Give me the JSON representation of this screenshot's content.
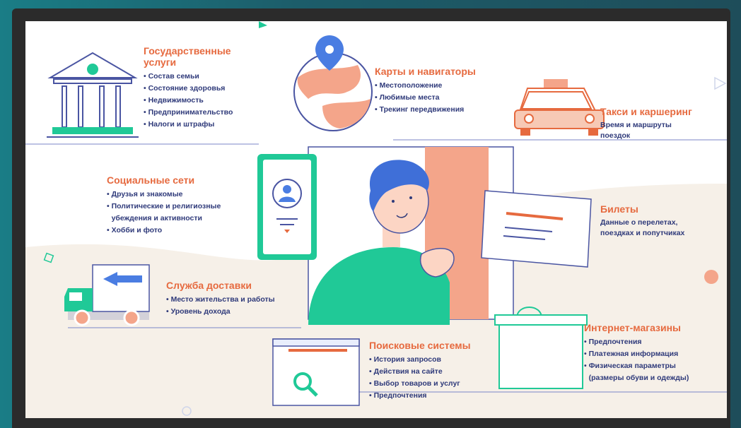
{
  "gov": {
    "title_line1": "Государственные",
    "title_line2": "услуги",
    "items": [
      "Состав семьи",
      "Состояние здоровья",
      "Недвижимость",
      "Предпринимательство",
      "Налоги и штрафы"
    ]
  },
  "maps": {
    "title": "Карты и навигаторы",
    "items": [
      "Местоположение",
      "Любимые места",
      "Трекинг  передвижения"
    ]
  },
  "taxi": {
    "title": "Такси и каршеринг",
    "desc_line1": "Время и маршруты",
    "desc_line2": "поездок"
  },
  "social": {
    "title": "Социальные сети",
    "items": [
      "Друзья и знакомые",
      "Политические и религиозные",
      "Хобби и фото"
    ],
    "item2_line2": "убеждения и активности"
  },
  "tickets": {
    "title": "Билеты",
    "desc_line1": "Данные о перелетах,",
    "desc_line2": "поездках и попутчиках"
  },
  "delivery": {
    "title": "Служба доставки",
    "items": [
      "Место жительства и работы",
      "Уровень дохода"
    ]
  },
  "search": {
    "title": "Поисковые системы",
    "items": [
      "История запросов",
      "Действия на сайте",
      "Выбор товаров и услуг",
      "Предпочтения"
    ]
  },
  "shops": {
    "title": "Интернет-магазины",
    "items": [
      "Предпочтения",
      "Платежная информация",
      "Физическая параметры"
    ],
    "item3_line2": "(размеры обуви и одежды)"
  },
  "colors": {
    "accent": "#e66a3f",
    "navy": "#2f3a7a",
    "teal": "#20c997",
    "peach": "#f4a58a"
  }
}
